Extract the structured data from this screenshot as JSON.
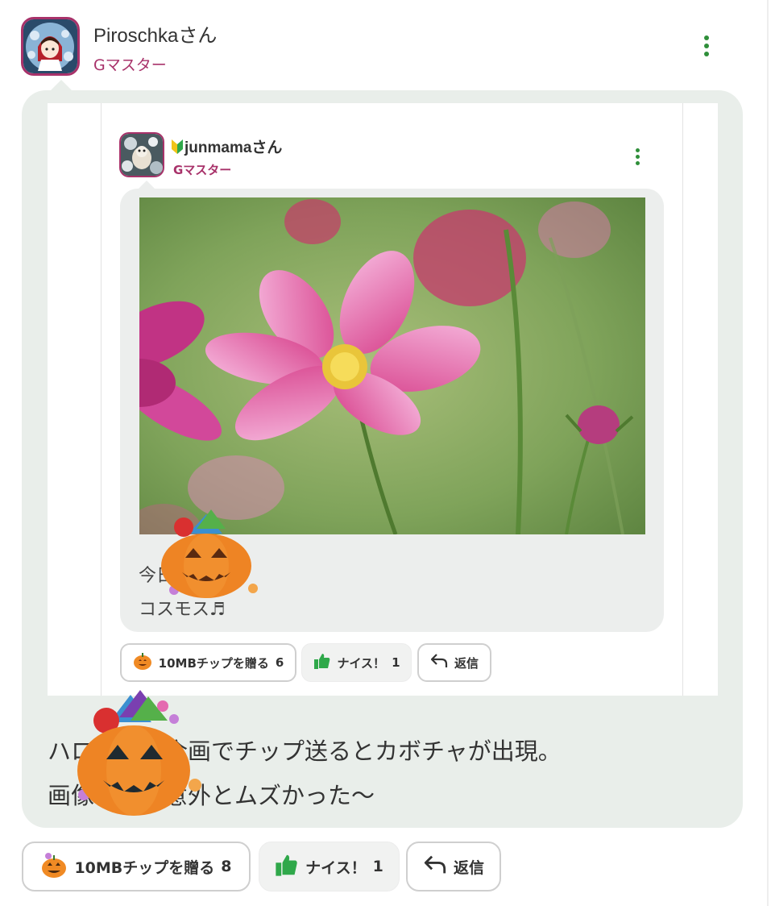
{
  "post": {
    "username": "Piroschkaさん",
    "rank": "Gマスター",
    "message_lines": [
      "ハロウィン企画でチップ送るとカボチャが出現。",
      "画像付きは意外とムズかった〜"
    ],
    "actions": {
      "tip_label": "10MBチップを贈る",
      "tip_count": "8",
      "nice_label": "ナイス！",
      "nice_count": "1",
      "reply_label": "返信"
    }
  },
  "embedded_post": {
    "username": "junmamaさん",
    "rank": "Gマスター",
    "text_lines": [
      "今日の",
      "コスモス♬"
    ],
    "actions": {
      "tip_label": "10MBチップを贈る",
      "tip_count": "6",
      "nice_label": "ナイス！",
      "nice_count": "1",
      "reply_label": "返信"
    }
  },
  "colors": {
    "accent": "#a8326a",
    "menu_dots": "#2f8f3a",
    "bubble": "#e9eeea",
    "thumb": "#2fa84a"
  },
  "icons": {
    "menu": "kebab-icon",
    "beginner": "beginner-mark-icon",
    "tip": "pumpkin-icon",
    "nice": "thumbs-up-icon",
    "reply": "reply-arrow-icon"
  }
}
